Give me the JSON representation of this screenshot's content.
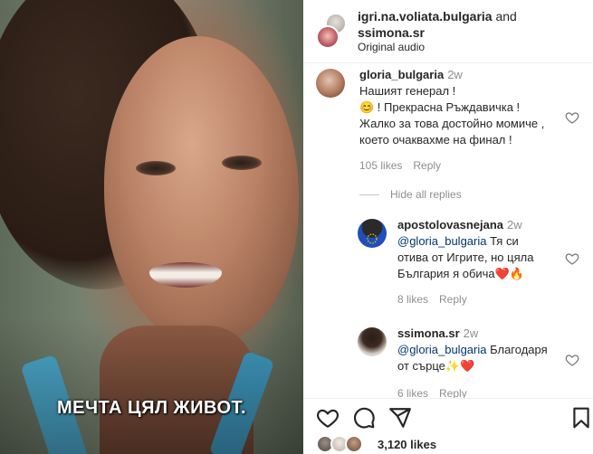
{
  "video": {
    "caption": "МЕЧТА ЦЯЛ ЖИВОТ."
  },
  "header": {
    "account1": "igri.na.voliata.bulgaria",
    "joiner": "and",
    "account2": "ssimona.sr",
    "audio": "Original audio"
  },
  "comments": [
    {
      "username": "gloria_bulgaria",
      "time": "2w",
      "lines": [
        "Нашият генерал !",
        "😊          ! Прекрасна Ръждавичка !",
        "Жалко за това достойно момиче ,",
        "което очаквахме на финал !"
      ],
      "likes": "105 likes",
      "reply": "Reply"
    }
  ],
  "hide_replies": "Hide all replies",
  "replies": [
    {
      "username": "apostolovasnejana",
      "time": "2w",
      "mention": "@gloria_bulgaria",
      "line1_rest": " Тя си",
      "line2": "отива от Игрите, но цяла",
      "line3": "България я обича❤️🔥",
      "likes": "8 likes",
      "reply": "Reply"
    },
    {
      "username": "ssimona.sr",
      "time": "2w",
      "mention": "@gloria_bulgaria",
      "line1_rest": " Благодаря",
      "line2": "от сърце✨❤️",
      "likes": "6 likes",
      "reply": "Reply"
    }
  ],
  "actions": {
    "icons": [
      "heart-icon",
      "comment-icon",
      "share-icon",
      "bookmark-icon"
    ],
    "likes_count": "3,120 likes"
  },
  "colors": {
    "text": "#262626",
    "secondary": "#8e8e8e",
    "mention": "#00376b",
    "strap": "#4aa6c9"
  }
}
